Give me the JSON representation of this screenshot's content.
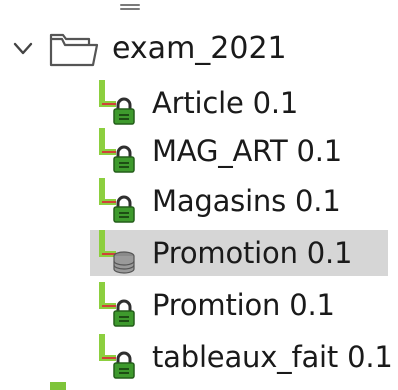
{
  "colors": {
    "connector_green": "#8ccf3f",
    "connector_red": "#d0413a",
    "lock_green": "#3e9a2d",
    "lock_shackle": "#2f2f2f",
    "selection_bg": "#d6d6d6"
  },
  "tree": {
    "folder": {
      "label": "exam_2021",
      "expanded": true,
      "icon": "folder-icon"
    },
    "items": [
      {
        "label": "Article 0.1",
        "icon": "lock-icon",
        "selected": false
      },
      {
        "label": "MAG_ART 0.1",
        "icon": "lock-icon",
        "selected": false
      },
      {
        "label": "Magasins 0.1",
        "icon": "lock-icon",
        "selected": false
      },
      {
        "label": "Promotion 0.1",
        "icon": "database-icon",
        "selected": true
      },
      {
        "label": "Promtion 0.1",
        "icon": "lock-icon",
        "selected": false
      },
      {
        "label": "tableaux_fait 0.1",
        "icon": "lock-icon",
        "selected": false
      }
    ]
  }
}
